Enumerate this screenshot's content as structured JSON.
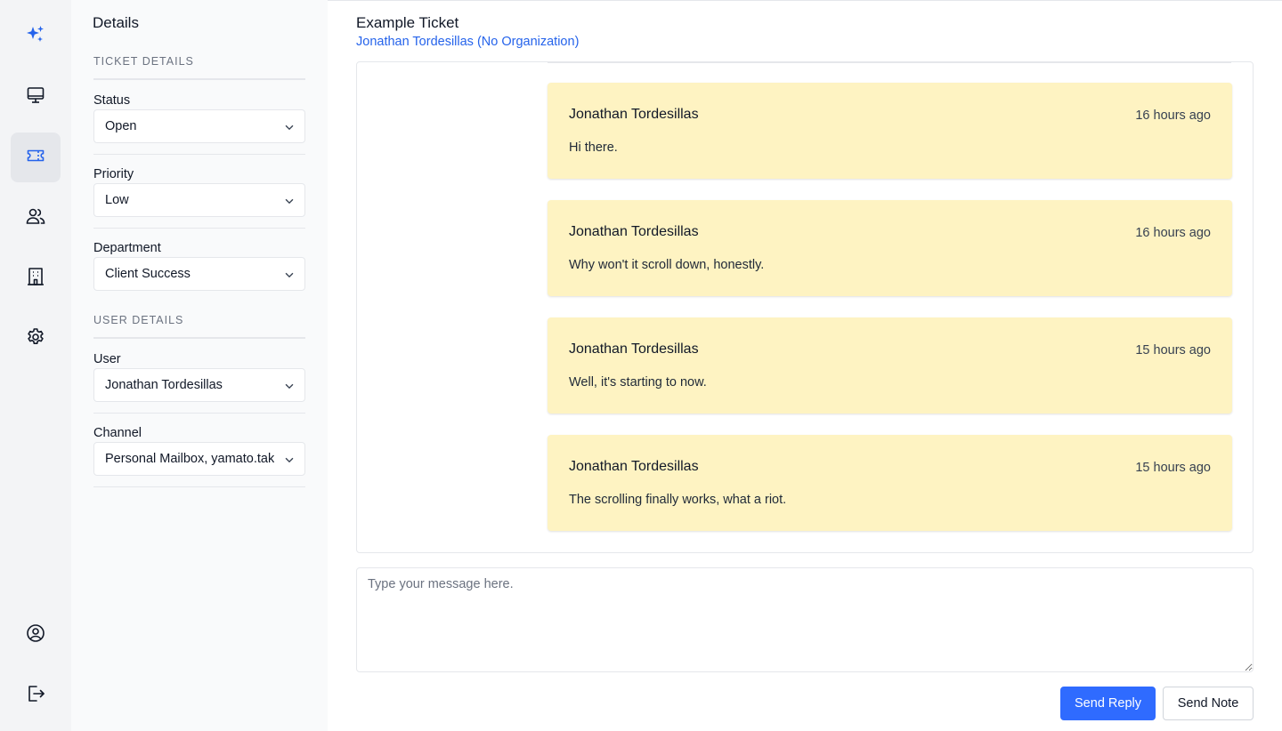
{
  "sidebar": {
    "items": [
      {
        "icon": "sparkles-icon",
        "name": "AI"
      },
      {
        "icon": "monitor-icon",
        "name": "Dashboard"
      },
      {
        "icon": "ticket-icon",
        "name": "Tickets",
        "active": true
      },
      {
        "icon": "users-icon",
        "name": "Users"
      },
      {
        "icon": "building-icon",
        "name": "Organizations"
      },
      {
        "icon": "gear-icon",
        "name": "Settings"
      }
    ],
    "bottom": [
      {
        "icon": "user-circle-icon",
        "name": "Profile"
      },
      {
        "icon": "logout-icon",
        "name": "Log out"
      }
    ],
    "accent_color": "#2563eb"
  },
  "details": {
    "title": "Details",
    "ticket_heading": "TICKET DETAILS",
    "status": {
      "label": "Status",
      "value": "Open"
    },
    "priority": {
      "label": "Priority",
      "value": "Low"
    },
    "department": {
      "label": "Department",
      "value": "Client Success"
    },
    "user_heading": "USER DETAILS",
    "user": {
      "label": "User",
      "value": "Jonathan Tordesillas"
    },
    "channel": {
      "label": "Channel",
      "value": "Personal Mailbox, yamato.takato"
    }
  },
  "ticket": {
    "title": "Example Ticket",
    "subtitle": "Jonathan Tordesillas (No Organization)"
  },
  "messages": [
    {
      "author": "Jonathan Tordesillas",
      "time": "16 hours ago",
      "body": "Hi there."
    },
    {
      "author": "Jonathan Tordesillas",
      "time": "16 hours ago",
      "body": "Why won't it scroll down, honestly."
    },
    {
      "author": "Jonathan Tordesillas",
      "time": "15 hours ago",
      "body": "Well, it's starting to now."
    },
    {
      "author": "Jonathan Tordesillas",
      "time": "15 hours ago",
      "body": "The scrolling finally works, what a riot."
    }
  ],
  "composer": {
    "placeholder": "Type your message here.",
    "value": "",
    "send_reply": "Send Reply",
    "send_note": "Send Note"
  },
  "colors": {
    "message_bg": "#fef3c2",
    "primary_button": "#2f6bff",
    "link": "#2563eb"
  }
}
